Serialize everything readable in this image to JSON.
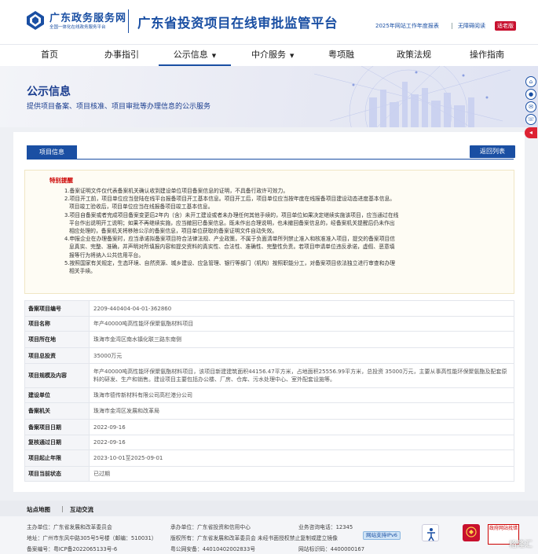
{
  "header": {
    "logo_title": "广东政务服务网",
    "logo_subtitle": "全国一体化在线政务服务平台",
    "site_title": "广东省投资项目在线审批监管平台",
    "report_link": "2025年网站工作年度报表",
    "accessible_link": "无障碍阅读",
    "care_badge": "适老版"
  },
  "nav": {
    "items": [
      {
        "label": "首页"
      },
      {
        "label": "办事指引"
      },
      {
        "label": "公示信息"
      },
      {
        "label": "中介服务"
      },
      {
        "label": "粤项融"
      },
      {
        "label": "政策法规"
      },
      {
        "label": "操作指南"
      }
    ],
    "dropdown_caret": "▼"
  },
  "banner": {
    "title": "公示信息",
    "subtitle": "提供项目备案、项目核准、项目审批等办理信息的公示服务"
  },
  "panel": {
    "tab_label": "项目信息",
    "back_label": "返回列表"
  },
  "notice": {
    "title": "特别提醒",
    "lines": [
      "1.备案证明文件仅代表备案机关确认收到建设单位项目备案信息的证明，不具备行政许可效力。",
      "2.项目开工前，项目单位应当登陆在线平台报备项目开工基本信息。项目开工后，项目单位应当按年度在线报备项目建设动态进度基本信息。",
      "项目竣工验收后，项目单位应当在线报备项目竣工基本信息。",
      "3.项目自备案或者完成项目备案变更后2年内（含）未开工建设或者未办理任何其他手续的，项目单位如果决定继续实施该项目，应当通过在线",
      "平台作出说明开工说明；如果不再继续实施，应当撤回已备案信息。既未作出合理说明，也未撤回备案信息的，经备案机关提醒后仍未作出",
      "相应处理的，备案机关将移除公示的备案信息，项目单位获取的备案证明文件自动失效。",
      "4.申报企业在办理备案时，应当承诺拟备案项目符合法律法规、产业政策，不属于负面清单所列禁止准入和核准准入项目，提交的备案项目信",
      "息真实、完整、准确，并声明对所填报内容和提交资料的真实性、合法性、准确性、完整性负责。若项目申请单位违反承诺，虚假、恶意填",
      "报等行为将纳入公共信用平台。",
      "5.按照国家有关规定，生态环境、自然资源、城乡建设、应急管理、银行等部门（机构）按照职能分工，对备案项目依法独立进行审查和办理",
      "相关手续。"
    ]
  },
  "info": {
    "rows": [
      {
        "label": "备案项目编号",
        "value": "2209-440404-04-01-362860"
      },
      {
        "label": "项目名称",
        "value": "年产40000吨高性能环保聚氨酯材料项目"
      },
      {
        "label": "项目所在地",
        "value": "珠海市金湾区南水镇化联三路东南侧"
      },
      {
        "label": "项目总投资",
        "value": "35000万元"
      },
      {
        "label": "项目规模及内容",
        "value": "年产40000吨高性能环保聚氨酯材料项目，该项目新建建筑面积44156.47平方米，占地面积25556.99平方米，总投资 35000万元，主要从事高性能环保聚氨酯及配套原料的研发、生产和销售。建设项目主要包括办公楼、厂房、仓库、污水处理中心、室外配套设施等。"
      },
      {
        "label": "建设单位",
        "value": "珠海市德传新材料有限公司高栏港分公司"
      },
      {
        "label": "备案机关",
        "value": "珠海市金湾区发展和改革局"
      },
      {
        "label": "备案项目日期",
        "value": "2022-09-16"
      },
      {
        "label": "复核通过日期",
        "value": "2022-09-16"
      },
      {
        "label": "项目起止年限",
        "value": "2023-10-01至2025-09-01"
      },
      {
        "label": "项目当前状态",
        "value": "已过期"
      }
    ]
  },
  "footer": {
    "links": [
      "站点地图",
      "互动交流"
    ],
    "sponsor": "主办单位：广东省发展和改革委员会",
    "organizer": "承办单位：广东省投资和信用中心",
    "hotline": "业务咨询电话：12345",
    "address": "地址：广州市东风中路305号5号楼（邮编：510031）",
    "copyright": "版权所有：广东省发展和改革委员会 未经书面授权禁止复制或建立镜像",
    "ipv6": "网站支持IPv6",
    "icp": "备案编号：粤ICP备2022065133号-6",
    "police": "粤公网安备：44010402002833号",
    "site_code": "网站标识码：4400000167",
    "gov_badge": "政府网站找错",
    "watermark": "格隆汇"
  },
  "colors": {
    "brand_blue": "#1a4fa3",
    "alert_red": "#cc0000",
    "care_red": "#c8102e"
  }
}
